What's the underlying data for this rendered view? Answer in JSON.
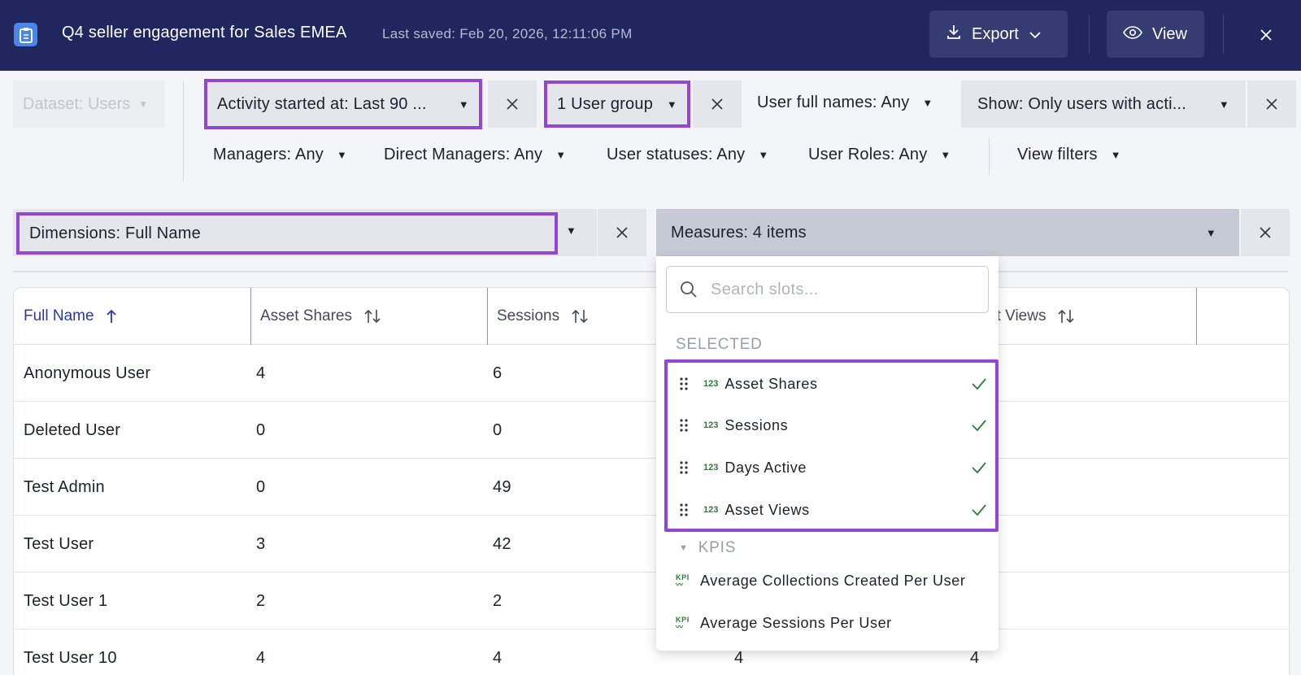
{
  "header": {
    "title": "Q4 seller engagement for Sales EMEA",
    "last_saved": "Last saved: Feb 20, 2026, 12:11:06 PM",
    "export_label": "Export",
    "view_label": "View"
  },
  "filters": {
    "dataset": "Dataset: Users",
    "activity": "Activity started at: Last 90 ...",
    "user_group": "1 User group",
    "user_full_names": "User full names: Any",
    "show": "Show: Only users with acti...",
    "managers": "Managers: Any",
    "direct_managers": "Direct Managers: Any",
    "user_statuses": "User statuses: Any",
    "user_roles": "User Roles: Any",
    "view_filters": "View filters"
  },
  "dimensions_label": "Dimensions: Full Name",
  "measures_label": "Measures: 4 items",
  "table": {
    "columns": [
      "Full Name",
      "Asset Shares",
      "Sessions",
      "Days Active",
      "Asset Views"
    ],
    "visible_asset_views_header": "et Views",
    "rows": [
      {
        "name": "Anonymous User",
        "shares": "4",
        "sessions": "6",
        "days": "",
        "views": ""
      },
      {
        "name": "Deleted User",
        "shares": "0",
        "sessions": "0",
        "days": "",
        "views": ""
      },
      {
        "name": "Test Admin",
        "shares": "0",
        "sessions": "49",
        "days": "",
        "views": ""
      },
      {
        "name": "Test User",
        "shares": "3",
        "sessions": "42",
        "days": "",
        "views": ""
      },
      {
        "name": "Test User 1",
        "shares": "2",
        "sessions": "2",
        "days": "",
        "views": ""
      },
      {
        "name": "Test User 10",
        "shares": "4",
        "sessions": "4",
        "days": "4",
        "views": "4"
      }
    ]
  },
  "dropdown": {
    "search_placeholder": "Search slots...",
    "selected_heading": "SELECTED",
    "selected_items": [
      "Asset Shares",
      "Sessions",
      "Days Active",
      "Asset Views"
    ],
    "numeric_badge": "123",
    "kpis_heading": "KPIS",
    "kpi_badge": "KPI",
    "kpi_items": [
      "Average Collections Created Per User",
      "Average Sessions Per User"
    ]
  },
  "colors": {
    "header_bg": "#20275e",
    "highlight": "#9146d4",
    "check": "#2e7a3a",
    "sort_active": "#2c39a5"
  }
}
